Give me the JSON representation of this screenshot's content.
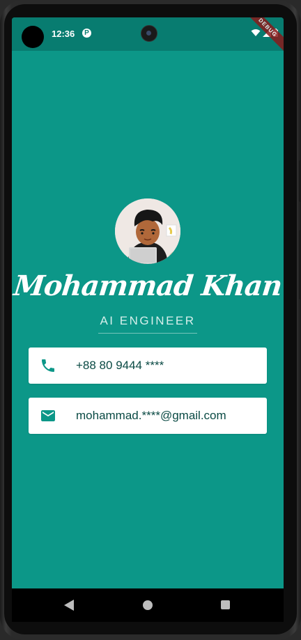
{
  "status_bar": {
    "time": "12:36",
    "notification_icon": "P",
    "debug_banner": "DEBUG"
  },
  "profile": {
    "avatar_alt": "profile-avatar",
    "name": "Mohammad Khan",
    "title": "AI ENGINEER"
  },
  "contacts": [
    {
      "icon": "phone-icon",
      "text": "+88 80 9444 ****"
    },
    {
      "icon": "email-icon",
      "text": "mohammad.****@gmail.com"
    }
  ],
  "colors": {
    "background": "#0c9788",
    "status_bar": "#087c70",
    "card": "#ffffff",
    "card_text": "#0a4a44",
    "icon": "#0c9788"
  }
}
